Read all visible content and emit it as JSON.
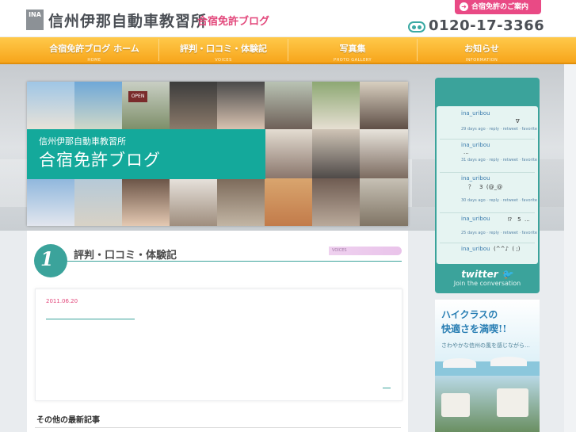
{
  "header": {
    "logo_text": "INA",
    "site_name": "信州伊那自動車教習所",
    "site_sub": "合宿免許ブログ",
    "guide_button": "合宿免許のご案内",
    "phone": "0120-17-3366"
  },
  "nav": {
    "items": [
      {
        "label": "合宿免許ブログ ホーム",
        "sub": "HOME"
      },
      {
        "label": "評判・口コミ・体験記",
        "sub": "VOICES"
      },
      {
        "label": "写真集",
        "sub": "PHOTO GALLERY"
      },
      {
        "label": "お知らせ",
        "sub": "INFORMATION"
      }
    ]
  },
  "hero": {
    "sub": "信州伊那自動車教習所",
    "title": "合宿免許ブログ",
    "open_sign": "OPEN"
  },
  "section": {
    "number": "1",
    "title": "評判・口コミ・体験記",
    "pill": "VOICES"
  },
  "post": {
    "date": "2011.06.20"
  },
  "latest": {
    "title": "その他の最新記事"
  },
  "twitter": {
    "tweets": [
      {
        "user": "ina_uribou",
        "text": "∇",
        "meta": "29 days ago · reply · retweet · favorite"
      },
      {
        "user": "ina_uribou",
        "text": "...",
        "meta": "31 days ago · reply · retweet · favorite"
      },
      {
        "user": "ina_uribou",
        "text": "？　3  (@_@",
        "meta": "30 days ago · reply · retweet · favorite"
      },
      {
        "user": "ina_uribou",
        "text": "⁉　5  ...",
        "meta": "25 days ago · reply · retweet · favorite"
      },
      {
        "user": "ina_uribou",
        "text": "(^^♪  ( ;)",
        "meta": ""
      }
    ],
    "logo": "twitter",
    "join": "Join the conversation"
  },
  "ad": {
    "line1": "ハイクラスの",
    "line2": "快適さを満喫!!",
    "copy": "さわやかな信州の風を感じながら…"
  },
  "colors": {
    "nav_orange": "#f7a51b",
    "teal": "#3ba39b",
    "pink": "#e94a85"
  }
}
